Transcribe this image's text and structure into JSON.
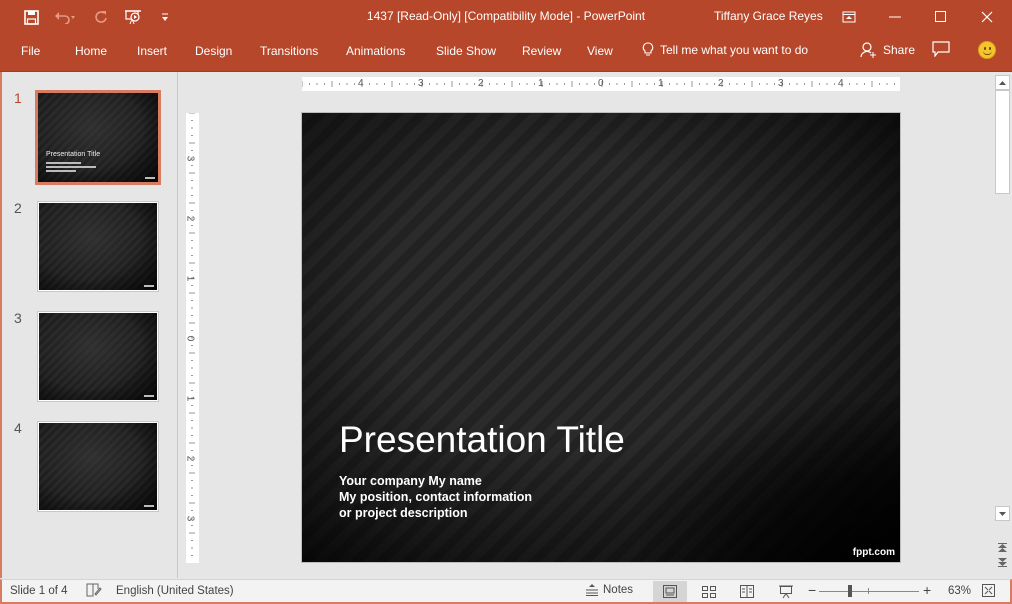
{
  "window": {
    "title": "1437 [Read-Only] [Compatibility Mode]  -  PowerPoint",
    "user": "Tiffany Grace Reyes",
    "controls": [
      "ribbon-display-options",
      "minimize",
      "maximize",
      "close"
    ]
  },
  "quick_access": {
    "icons": [
      "save-icon",
      "undo-icon",
      "redo-icon",
      "start-from-beginning-icon",
      "customize-qat-icon"
    ]
  },
  "ribbon": {
    "tabs": [
      {
        "label": "File"
      },
      {
        "label": "Home"
      },
      {
        "label": "Insert"
      },
      {
        "label": "Design"
      },
      {
        "label": "Transitions"
      },
      {
        "label": "Animations"
      },
      {
        "label": "Slide Show"
      },
      {
        "label": "Review"
      },
      {
        "label": "View"
      }
    ],
    "tell_me": "Tell me what you want to do",
    "share": "Share"
  },
  "thumbnails": [
    {
      "number": "1",
      "title": "Presentation Title",
      "active": true
    },
    {
      "number": "2",
      "active": false
    },
    {
      "number": "3",
      "active": false
    },
    {
      "number": "4",
      "active": false
    }
  ],
  "rulers": {
    "horizontal": [
      "4",
      "3",
      "2",
      "1",
      "0",
      "1",
      "2",
      "3",
      "4"
    ],
    "vertical": [
      "3",
      "2",
      "1",
      "0",
      "1",
      "2",
      "3"
    ]
  },
  "slide": {
    "title": "Presentation Title",
    "subtitle_lines": [
      "Your company My name",
      "My position, contact information",
      "or project description"
    ],
    "logo": "fppt.com"
  },
  "status": {
    "slide_indicator": "Slide 1 of 4",
    "language": "English (United States)",
    "notes": "Notes",
    "zoom": "63%",
    "zoom_value_percent": 63
  },
  "colors": {
    "accent": "#b7472a",
    "thumb_highlight": "#d77b63"
  }
}
